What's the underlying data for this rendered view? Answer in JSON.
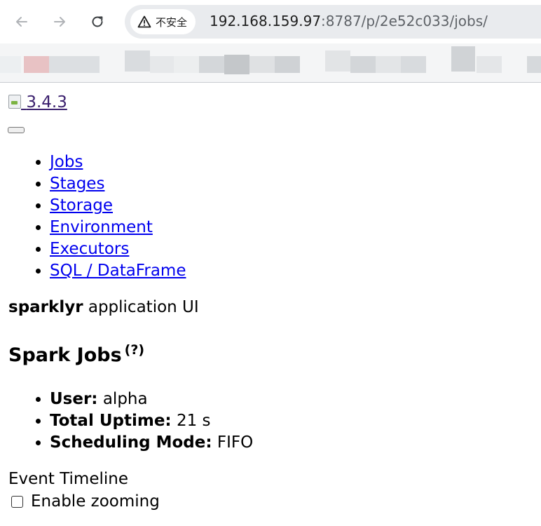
{
  "browser": {
    "security_label": "不安全",
    "url_host": "192.168.159.97",
    "url_rest": ":8787/p/2e52c033/jobs/",
    "icons": {
      "back": "arrow-left-icon",
      "forward": "arrow-right-icon",
      "reload": "reload-icon",
      "security": "warning-triangle-icon"
    }
  },
  "header": {
    "version": "3.4.3"
  },
  "nav": {
    "items": [
      {
        "label": "Jobs"
      },
      {
        "label": "Stages"
      },
      {
        "label": "Storage"
      },
      {
        "label": "Environment"
      },
      {
        "label": "Executors"
      },
      {
        "label": "SQL / DataFrame"
      }
    ]
  },
  "app": {
    "name": "sparklyr",
    "suffix": "application UI"
  },
  "page": {
    "title": "Spark Jobs",
    "help_mark": "(?)"
  },
  "summary": {
    "user_label": "User:",
    "user_value": "alpha",
    "uptime_label": "Total Uptime:",
    "uptime_value": "21 s",
    "mode_label": "Scheduling Mode:",
    "mode_value": "FIFO"
  },
  "timeline": {
    "heading": "Event Timeline",
    "zoom_label": "Enable zooming"
  }
}
